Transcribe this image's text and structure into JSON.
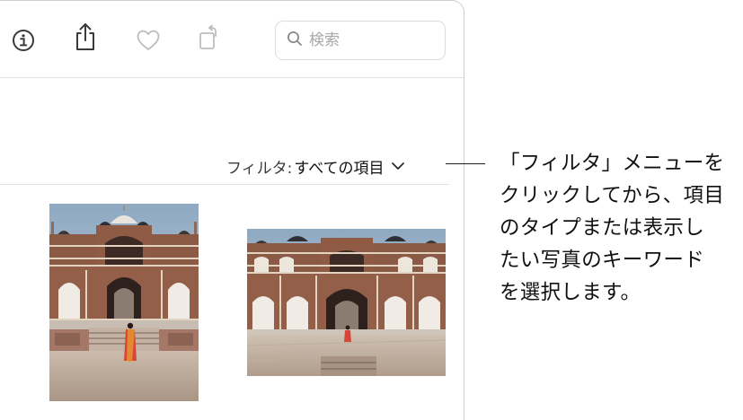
{
  "toolbar": {
    "icons": [
      {
        "name": "info-icon"
      },
      {
        "name": "share-icon"
      },
      {
        "name": "heart-icon"
      },
      {
        "name": "rotate-icon"
      }
    ],
    "search": {
      "placeholder": "検索",
      "value": "",
      "icon": "search-icon"
    }
  },
  "filter": {
    "prefix": "フィルタ:",
    "value": "すべての項目",
    "icon": "chevron-down-icon"
  },
  "photos": [
    {
      "name": "photo-1",
      "orientation": "portrait",
      "subject": "Humayun's Tomb with person"
    },
    {
      "name": "photo-2",
      "orientation": "landscape",
      "subject": "Humayun's Tomb with person"
    }
  ],
  "callout": {
    "lines": [
      "「フィルタ」メニューを",
      "クリックしてから、項目",
      "のタイプまたは表示し",
      "たい写真のキーワード",
      "を選択します。"
    ]
  },
  "colors": {
    "sky": "#9cb3c9",
    "sandstone": "#8e5a44",
    "marble": "#e6ded2",
    "ground": "#b7a696",
    "person": "#d6473a"
  }
}
